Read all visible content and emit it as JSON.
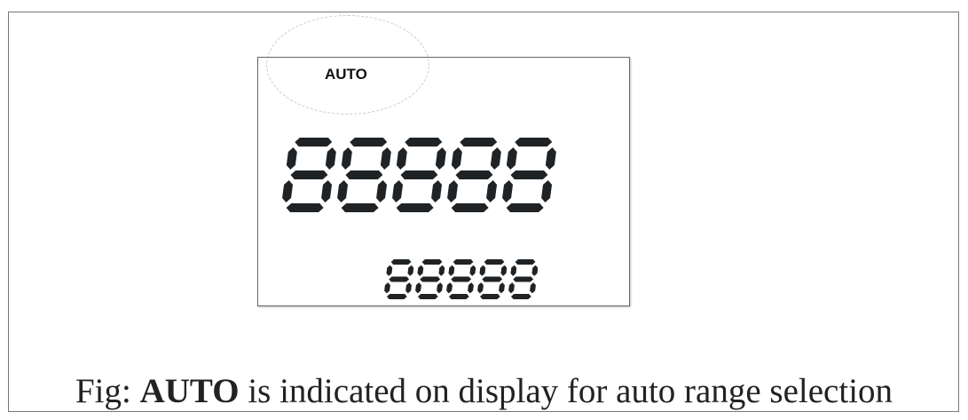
{
  "display": {
    "mode_indicator": "AUTO",
    "main_readout": "88888",
    "sub_readout": "88888"
  },
  "caption": {
    "prefix": "Fig:",
    "highlight": "AUTO",
    "suffix": "is indicated on display for auto range selection"
  },
  "colors": {
    "segment": "#1f2326",
    "panel_border": "#666666",
    "ellipse": "#c9c9c9"
  }
}
